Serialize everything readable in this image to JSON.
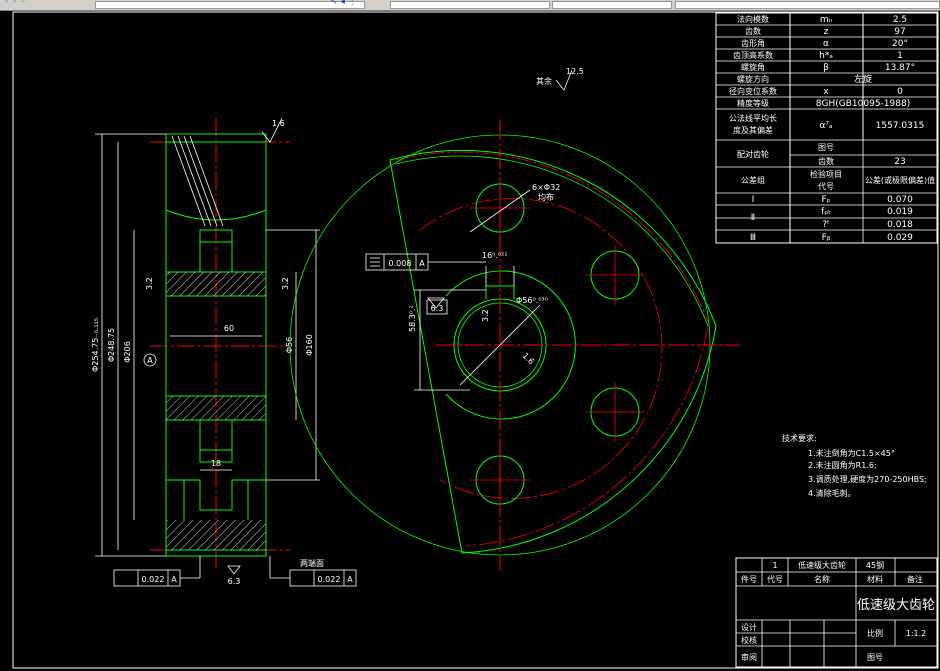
{
  "window": {
    "toolbar_left_glyph": "◦ ◦ ◦",
    "toolbar_right_glyph": "↖ ◂ ⋮"
  },
  "colors": {
    "background": "#000000",
    "outline": "#00ff00",
    "centerline": "#ff0000",
    "text": "#ffffff"
  },
  "param_table": {
    "rows": [
      {
        "name": "法向模数",
        "symbol": "mₙ",
        "value": "2.5"
      },
      {
        "name": "齿数",
        "symbol": "z",
        "value": "97"
      },
      {
        "name": "齿形角",
        "symbol": "α",
        "value": "20°"
      },
      {
        "name": "齿顶高系数",
        "symbol": "h*ₐ",
        "value": "1"
      },
      {
        "name": "螺旋角",
        "symbol": "β",
        "value": "13.87°"
      },
      {
        "name": "螺旋方向",
        "symbol": "",
        "value": "左旋"
      },
      {
        "name": "径向变位系数",
        "symbol": "x",
        "value": "0"
      },
      {
        "name": "精度等级",
        "symbol": "",
        "value": "8GH(GB10095-1988)"
      },
      {
        "name": "公法线平均长",
        "symbol": "",
        "value": ""
      },
      {
        "name": "度及其偏差",
        "symbol": "α⁷ₐ",
        "value": "1557.0315"
      }
    ],
    "mating_label": "配对齿轮",
    "mating_sub1": "图号",
    "mating_sub2": "齿数",
    "mating_teeth": "23",
    "tolerance_group_label": "公差组",
    "check_item_header": "检验项目",
    "code_header": "代号",
    "tolerance_header": "公差(或极限偏差)值",
    "groups": [
      {
        "group": "Ⅰ",
        "code": "Fₚ",
        "value": "0.070"
      },
      {
        "group": "Ⅱ",
        "code": "fₚₜ",
        "value": "0.019"
      },
      {
        "group": "",
        "code": "?ᶠ",
        "value": "0.018"
      },
      {
        "group": "Ⅲ",
        "code": "Fᵦ",
        "value": "0.029"
      }
    ]
  },
  "section_view": {
    "roughness_top": "1.6",
    "dim_outer": "Φ254.75₋₀.₁₁₅",
    "dim_root": "Φ248.75",
    "dim_web": "Φ206",
    "dim_hub": "Φ160",
    "dim_bore": "Φ56",
    "dim_width": "60",
    "dim_slot": "18",
    "roughness_left": "3.2",
    "roughness_right": "3.2",
    "datum": "A",
    "roughness_bottom": "6.3",
    "note_bottom": "两端面",
    "runout_left": "0.022",
    "runout_left_datum": "A",
    "runout_right": "0.022",
    "runout_right_datum": "A"
  },
  "front_view": {
    "remaining_label": "其余",
    "remaining_roughness": "12.5",
    "hole_label": "6×Φ32",
    "hole_sub": "均布",
    "keyway_width": "16⁰.⁰²¹",
    "bore_label": "Φ56⁰.⁰³⁰",
    "keyway_depth": "58.3⁰.²",
    "flatness_value": "0.008",
    "flatness_datum": "A",
    "roughness_keyway": "3.2",
    "roughness_bore": "1.6",
    "roughness_left": "6.3"
  },
  "requirements": {
    "title": "技术要求:",
    "items": [
      "1.未注倒角为C1.5×45°",
      "2.未注圆角为R1.6;",
      "3.调质处理,硬度为270-250HBS;",
      "4.清除毛刺。"
    ]
  },
  "title_block": {
    "qty": "1",
    "part_name_small": "低速级大齿轮",
    "material": "45钢",
    "h_no": "件号",
    "h_code": "代号",
    "h_name": "名称",
    "h_material": "材料",
    "h_remark": "备注",
    "drawing_title": "低速级大齿轮",
    "row_design": "设计",
    "row_check": "校核",
    "row_approve": "审阅",
    "scale_label": "比例",
    "scale_value": "1:1.2",
    "drawing_no_label": "图号"
  }
}
